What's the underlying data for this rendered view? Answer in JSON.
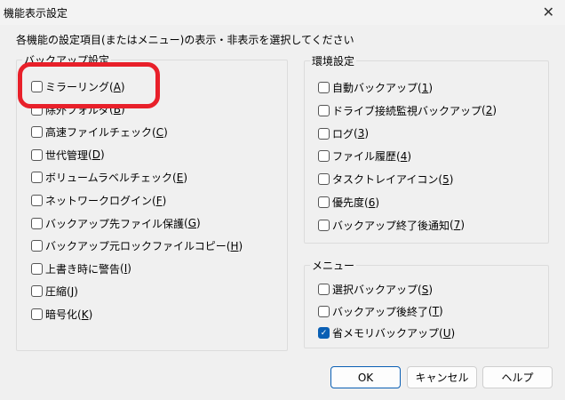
{
  "window": {
    "title": "機能表示設定",
    "close": "✕"
  },
  "instruction": "各機能の設定項目(またはメニュー)の表示・非表示を選択してください",
  "backup_group": {
    "label": "バックアップ設定",
    "items": [
      {
        "label": "ミラーリング",
        "key": "A",
        "checked": false
      },
      {
        "label": "除外フォルダ",
        "key": "B",
        "checked": false
      },
      {
        "label": "高速ファイルチェック",
        "key": "C",
        "checked": false
      },
      {
        "label": "世代管理",
        "key": "D",
        "checked": false
      },
      {
        "label": "ボリュームラベルチェック",
        "key": "E",
        "checked": false
      },
      {
        "label": "ネットワークログイン",
        "key": "F",
        "checked": false
      },
      {
        "label": "バックアップ先ファイル保護",
        "key": "G",
        "checked": false
      },
      {
        "label": "バックアップ元ロックファイルコピー",
        "key": "H",
        "checked": false
      },
      {
        "label": "上書き時に警告",
        "key": "I",
        "checked": false
      },
      {
        "label": "圧縮",
        "key": "J",
        "checked": false
      },
      {
        "label": "暗号化",
        "key": "K",
        "checked": false
      }
    ]
  },
  "env_group": {
    "label": "環境設定",
    "items": [
      {
        "label": "自動バックアップ",
        "key": "1",
        "checked": false
      },
      {
        "label": "ドライブ接続監視バックアップ",
        "key": "2",
        "checked": false
      },
      {
        "label": "ログ",
        "key": "3",
        "checked": false
      },
      {
        "label": "ファイル履歴",
        "key": "4",
        "checked": false
      },
      {
        "label": "タスクトレイアイコン",
        "key": "5",
        "checked": false
      },
      {
        "label": "優先度",
        "key": "6",
        "checked": false
      },
      {
        "label": "バックアップ終了後通知",
        "key": "7",
        "checked": false
      }
    ]
  },
  "menu_group": {
    "label": "メニュー",
    "items": [
      {
        "label": "選択バックアップ",
        "key": "S",
        "checked": false
      },
      {
        "label": "バックアップ後終了",
        "key": "T",
        "checked": false
      },
      {
        "label": "省メモリバックアップ",
        "key": "U",
        "checked": true
      }
    ]
  },
  "buttons": {
    "ok": "OK",
    "cancel": "キャンセル",
    "help": "ヘルプ"
  },
  "colors": {
    "highlight": "#e8202a",
    "accent": "#0a5fb4"
  }
}
